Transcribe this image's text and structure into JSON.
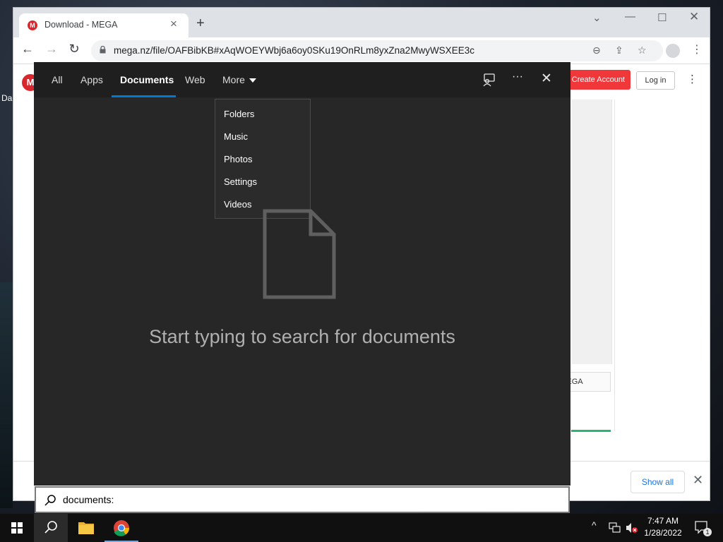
{
  "desktop": {
    "icon_label": "Da"
  },
  "browser": {
    "tab_title": "Download - MEGA",
    "tab_favicon_letter": "M",
    "url": "mega.nz/file/OAFBibKB#xAqWOEYWbj6a6oy0SKu19OnRLm8yxZna2MwyWSXEE3c",
    "icons": {
      "back": "arrow-left-icon",
      "forward": "arrow-right-icon",
      "reload": "reload-icon",
      "lock": "lock-icon",
      "zoom": "zoom-out-icon",
      "share": "share-icon",
      "bookmark": "star-icon",
      "profile": "profile-icon",
      "menu": "kebab-menu-icon"
    }
  },
  "mega_page": {
    "logo_letter": "M",
    "create_account": "Create Account",
    "log_in": "Log in",
    "to_mega": "Download to MEGA"
  },
  "download_bar": {
    "show_all": "Show all"
  },
  "search_flyout": {
    "tabs": [
      "All",
      "Apps",
      "Documents",
      "Web",
      "More"
    ],
    "active_tab": "Documents",
    "more_menu": [
      "Folders",
      "Music",
      "Photos",
      "Settings",
      "Videos"
    ],
    "empty_prompt": "Start typing to search for documents",
    "query": "documents:"
  },
  "taskbar": {
    "time": "7:47 AM",
    "date": "1/28/2022",
    "notification_count": "1"
  },
  "colors": {
    "accent": "#0078d4",
    "mega_red": "#d9272e",
    "flyout_bg": "#272727",
    "progress": "#2bb573"
  }
}
